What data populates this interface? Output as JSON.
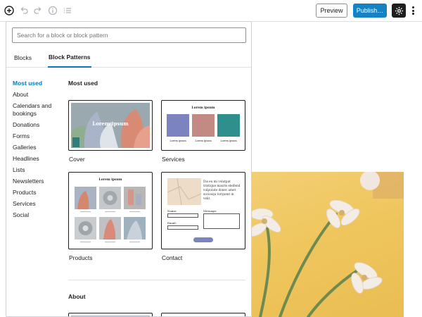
{
  "toolbar": {
    "preview_label": "Preview",
    "publish_label": "Publish…",
    "icons": [
      "plus-icon",
      "undo-icon",
      "redo-icon",
      "info-icon",
      "list-view-icon",
      "gear-icon",
      "more-icon"
    ]
  },
  "inserter": {
    "search_placeholder": "Search for a block or block pattern",
    "tabs": [
      "Blocks",
      "Block Patterns"
    ],
    "active_tab": "Block Patterns",
    "categories": [
      "Most used",
      "About",
      "Calendars and bookings",
      "Donations",
      "Forms",
      "Galleries",
      "Headlines",
      "Lists",
      "Newsletters",
      "Products",
      "Services",
      "Social"
    ],
    "active_category": "Most used",
    "sections": [
      {
        "title": "Most used",
        "patterns": [
          "Cover",
          "Services",
          "Products",
          "Contact"
        ]
      },
      {
        "title": "About"
      }
    ],
    "preview_text": {
      "cover": "Lorem ipsum",
      "services_heading": "Lorem ipsum",
      "services_captions": [
        "Lorem ipsum",
        "Lorem ipsum",
        "Lorem ipsum"
      ],
      "products_heading": "Lorem ipsum",
      "contact_text": "Dis eu mi volutpat tristique mauris eleifend vulputate donec amet sociosqu torquent in velit.",
      "contact_fields": [
        "Name:",
        "Email:",
        "Message:"
      ]
    }
  },
  "colors": {
    "accent": "#007cba",
    "publish": "#1582c4",
    "services_swatches": [
      "#7c84bf",
      "#c28a82",
      "#2e8f8c"
    ]
  }
}
